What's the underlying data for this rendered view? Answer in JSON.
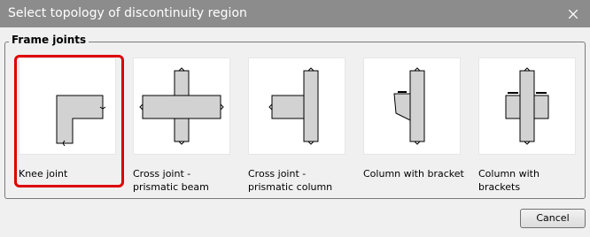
{
  "window": {
    "title": "Select topology of discontinuity region"
  },
  "group": {
    "legend": "Frame joints"
  },
  "tiles": [
    {
      "label_line1": "Knee joint",
      "label_line2": "",
      "selected": true
    },
    {
      "label_line1": "Cross joint -",
      "label_line2": "prismatic beam",
      "selected": false
    },
    {
      "label_line1": "Cross joint -",
      "label_line2": "prismatic column",
      "selected": false
    },
    {
      "label_line1": "Column with bracket",
      "label_line2": "",
      "selected": false
    },
    {
      "label_line1": "Column with",
      "label_line2": "brackets",
      "selected": false
    }
  ],
  "buttons": {
    "cancel": "Cancel"
  },
  "colors": {
    "titlebar": "#8c8c8c",
    "selection": "#dd0000",
    "member_fill": "#d2d2d2"
  }
}
